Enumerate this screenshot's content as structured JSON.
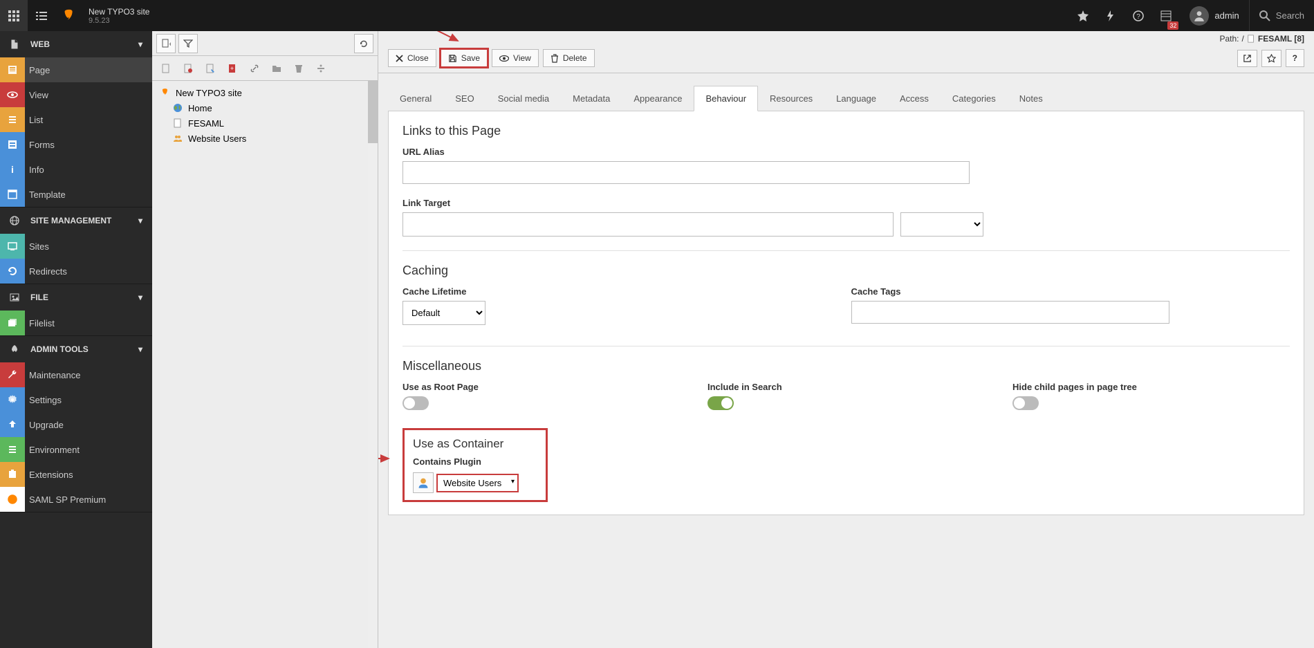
{
  "topbar": {
    "site_title": "New TYPO3 site",
    "version": "9.5.23",
    "badge_count": "32",
    "username": "admin",
    "search_placeholder": "Search"
  },
  "modmenu": {
    "groups": [
      {
        "label": "WEB",
        "items": [
          {
            "label": "Page",
            "active": true,
            "color": "orange"
          },
          {
            "label": "View",
            "color": "red"
          },
          {
            "label": "List",
            "color": "orange"
          },
          {
            "label": "Forms",
            "color": "blue"
          },
          {
            "label": "Info",
            "color": "blue"
          },
          {
            "label": "Template",
            "color": "blue"
          }
        ]
      },
      {
        "label": "SITE MANAGEMENT",
        "items": [
          {
            "label": "Sites",
            "color": "teal"
          },
          {
            "label": "Redirects",
            "color": "blue"
          }
        ]
      },
      {
        "label": "FILE",
        "items": [
          {
            "label": "Filelist",
            "color": "green"
          }
        ]
      },
      {
        "label": "ADMIN TOOLS",
        "items": [
          {
            "label": "Maintenance",
            "color": "red"
          },
          {
            "label": "Settings",
            "color": "blue"
          },
          {
            "label": "Upgrade",
            "color": "blue"
          },
          {
            "label": "Environment",
            "color": "green"
          },
          {
            "label": "Extensions",
            "color": "orange"
          },
          {
            "label": "SAML SP Premium",
            "color": "orange"
          }
        ]
      }
    ]
  },
  "pagetree": {
    "root": "New TYPO3 site",
    "nodes": [
      {
        "label": "Home",
        "icon": "globe"
      },
      {
        "label": "FESAML",
        "icon": "page"
      },
      {
        "label": "Website Users",
        "icon": "users"
      }
    ]
  },
  "docheader": {
    "close": "Close",
    "save": "Save",
    "view": "View",
    "delete": "Delete",
    "path_label": "Path:",
    "path_root": "/",
    "path_page": "FESAML [8]"
  },
  "tabs": [
    "General",
    "SEO",
    "Social media",
    "Metadata",
    "Appearance",
    "Behaviour",
    "Resources",
    "Language",
    "Access",
    "Categories",
    "Notes"
  ],
  "active_tab": "Behaviour",
  "form": {
    "links": {
      "heading": "Links to this Page",
      "url_alias_label": "URL Alias",
      "url_alias_value": "",
      "link_target_label": "Link Target",
      "link_target_value": ""
    },
    "caching": {
      "heading": "Caching",
      "lifetime_label": "Cache Lifetime",
      "lifetime_value": "Default",
      "tags_label": "Cache Tags",
      "tags_value": ""
    },
    "misc": {
      "heading": "Miscellaneous",
      "root_label": "Use as Root Page",
      "search_label": "Include in Search",
      "hide_label": "Hide child pages in page tree"
    },
    "container": {
      "heading": "Use as Container",
      "plugin_label": "Contains Plugin",
      "plugin_value": "Website Users"
    }
  }
}
